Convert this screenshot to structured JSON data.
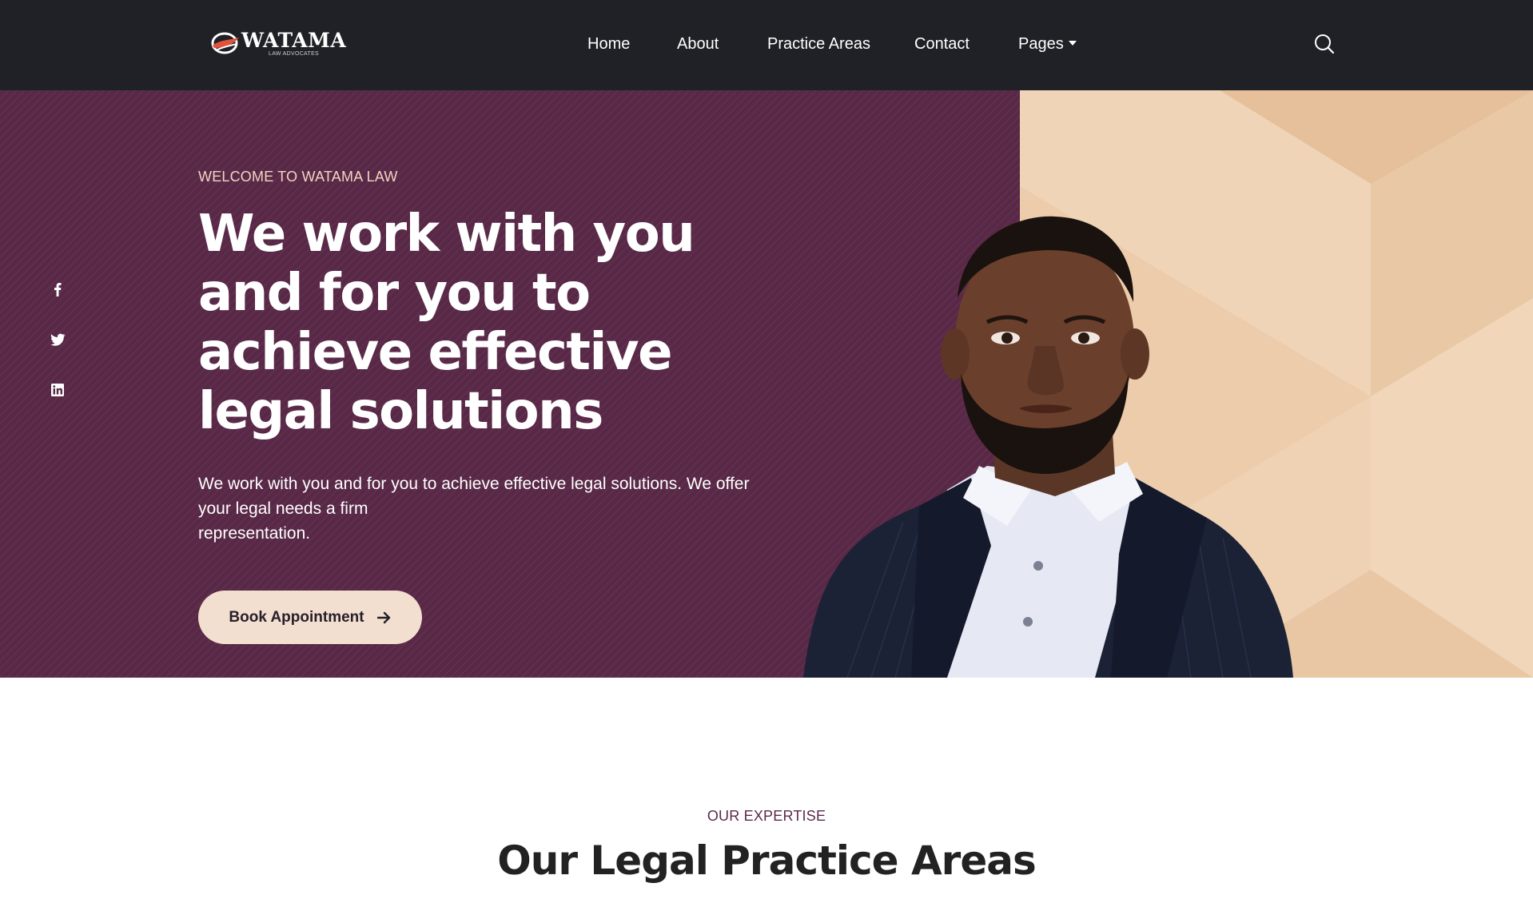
{
  "brand": {
    "name": "WATAMA",
    "tagline": "LAW ADVOCATES"
  },
  "nav": {
    "items": [
      {
        "label": "Home"
      },
      {
        "label": "About"
      },
      {
        "label": "Practice Areas"
      },
      {
        "label": "Contact"
      },
      {
        "label": "Pages"
      }
    ],
    "search_icon": "search-icon",
    "pages_dropdown_icon": "caret-down-icon"
  },
  "social": [
    {
      "icon": "facebook-icon"
    },
    {
      "icon": "twitter-icon"
    },
    {
      "icon": "linkedin-icon"
    }
  ],
  "hero": {
    "eyebrow": "WELCOME TO WATAMA LAW",
    "title_lines": [
      "We work with you",
      "and for you to",
      "achieve effective",
      "legal solutions"
    ],
    "text_lines": [
      "We work with you and for you to achieve effective legal solutions. We offer",
      "your legal needs a firm",
      "representation."
    ],
    "button_label": "Book Appointment",
    "button_icon": "arrow-right-icon"
  },
  "expertise": {
    "eyebrow": "OUR EXPERTISE",
    "title": "Our Legal Practice Areas"
  },
  "colors": {
    "header_bg": "#1f2126",
    "hero_bg": "#582846",
    "accent_peach": "#edcfae",
    "button_bg": "#f3dfd0"
  }
}
